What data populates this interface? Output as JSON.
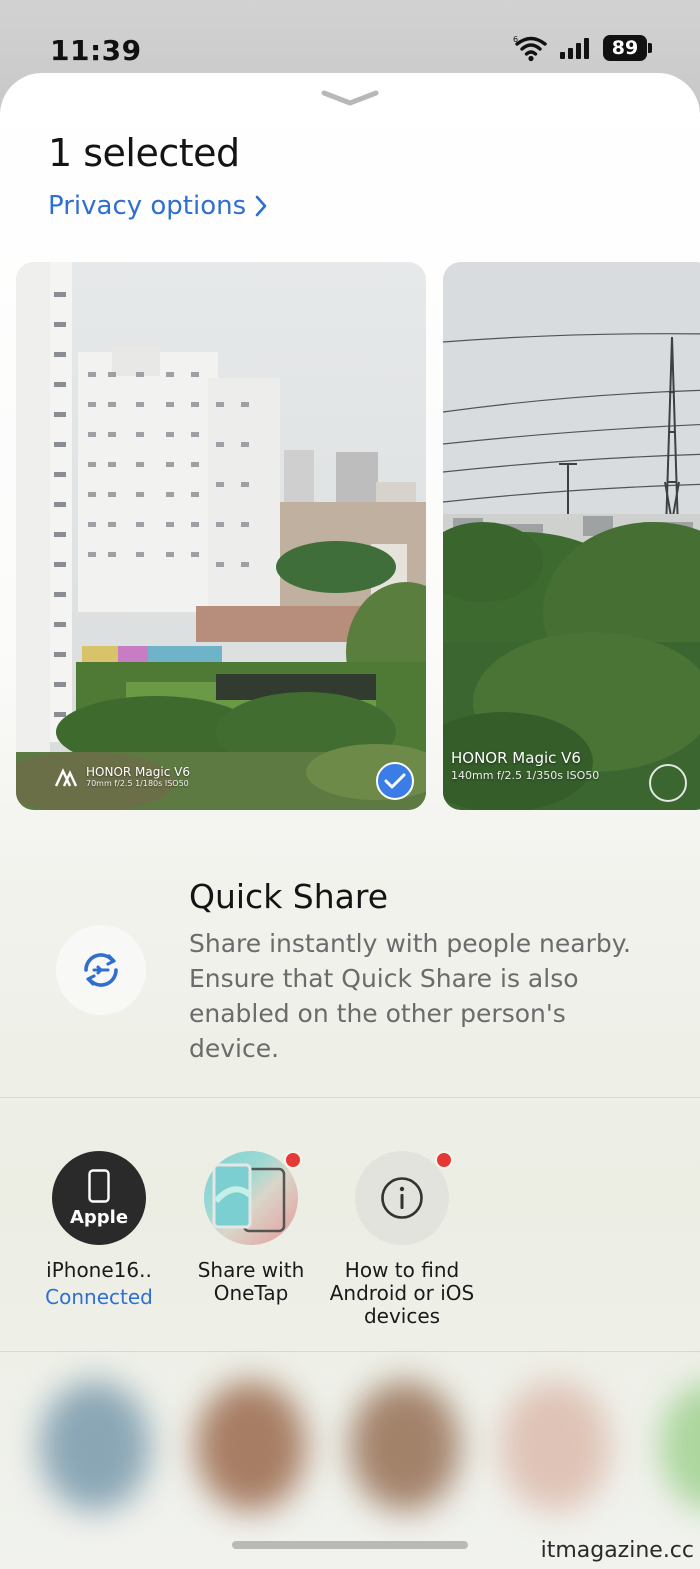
{
  "status_bar": {
    "time": "11:39",
    "battery": "89",
    "icons": [
      "wifi-icon",
      "signal-icon",
      "battery-icon"
    ]
  },
  "sheet": {
    "handle_icon": "chevron-down-icon",
    "title": "1 selected",
    "privacy_label": "Privacy options",
    "privacy_icon": "chevron-right-icon"
  },
  "photos": [
    {
      "brand": "HONOR Magic V6",
      "spec": "70mm  f/2.5  1/180s  ISO50",
      "selected": true
    },
    {
      "brand": "HONOR Magic V6",
      "spec": "140mm  f/2.5  1/350s  ISO50",
      "selected": false
    }
  ],
  "quick_share": {
    "icon": "quick-share-icon",
    "title": "Quick Share",
    "description": "Share instantly with people nearby. Ensure that Quick Share is also enabled on the other person's device."
  },
  "targets": [
    {
      "icon": "phone-icon",
      "badge": "Apple",
      "name": "iPhone16..",
      "status": "Connected"
    },
    {
      "icon": "onetap-icon",
      "name": "Share with OneTap"
    },
    {
      "icon": "info-icon",
      "name": "How to find Android or iOS devices"
    }
  ],
  "watermark_site": "itmagazine.cc",
  "colors": {
    "accent": "#2f6fd0",
    "badge_blue": "#3a7de6",
    "notification_red": "#e53935"
  }
}
